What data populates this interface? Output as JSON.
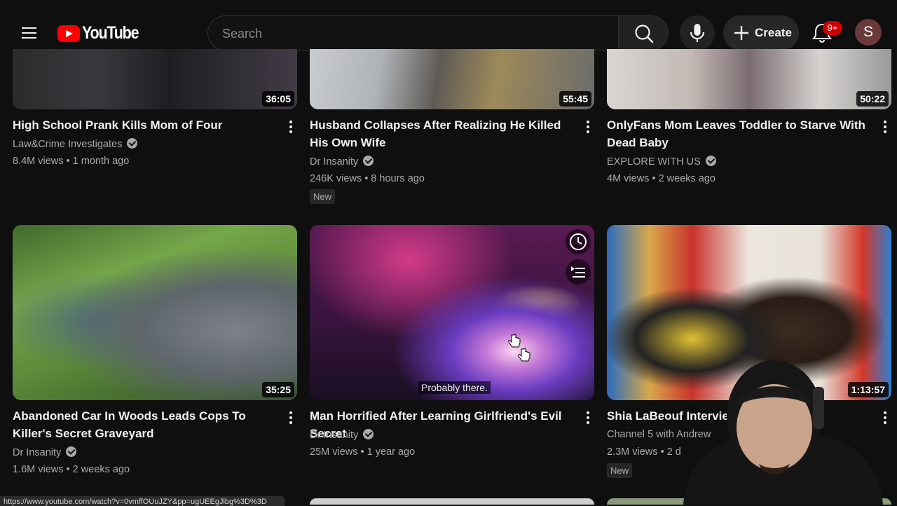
{
  "header": {
    "logo_text": "YouTube",
    "search_placeholder": "Search",
    "create_label": "Create",
    "notification_count": "9+",
    "avatar_letter": "S"
  },
  "videos": [
    {
      "title": "High School Prank Kills Mom of Four",
      "channel": "Law&Crime Investigates",
      "views": "8.4M views",
      "age": "1 month ago",
      "duration": "36:05"
    },
    {
      "title": "Husband Collapses After Realizing He Killed His Own Wife",
      "channel": "Dr Insanity",
      "views": "246K views",
      "age": "8 hours ago",
      "duration": "55:45",
      "badge": "New"
    },
    {
      "title": "OnlyFans Mom Leaves Toddler to Starve With Dead Baby",
      "channel": "EXPLORE WITH US",
      "views": "4M views",
      "age": "2 weeks ago",
      "duration": "50:22"
    },
    {
      "title": "Abandoned Car In Woods Leads Cops To Killer's Secret Graveyard",
      "channel": "Dr Insanity",
      "views": "1.6M views",
      "age": "2 weeks ago",
      "duration": "35:25"
    },
    {
      "title": "Man Horrified After Learning Girlfriend's Evil Secret",
      "channel": "Dr Insanity",
      "views": "25M views",
      "age": "1 year ago",
      "caption": "Probably there."
    },
    {
      "title": "Shia LaBeouf Interview",
      "channel": "Channel 5 with Andrew",
      "views": "2.3M views",
      "age": "2 d",
      "duration": "1:13:57",
      "badge": "New"
    }
  ],
  "meta_separator": "•",
  "status_bar_url": "https://www.youtube.com/watch?v=0vmffOUuJZY&pp=ugUEEgJlbg%3D%3D",
  "colors": {
    "background": "#0f0f0f",
    "brand_red": "#ff0000",
    "badge_red": "#cc0000",
    "text": "#f1f1f1",
    "secondary_text": "#aaaaaa"
  },
  "icons": [
    "menu-icon",
    "youtube-logo-icon",
    "search-icon",
    "microphone-icon",
    "plus-icon",
    "bell-icon",
    "verified-icon",
    "more-vert-icon",
    "watch-later-icon",
    "add-to-queue-icon",
    "hand-cursor-icon"
  ]
}
